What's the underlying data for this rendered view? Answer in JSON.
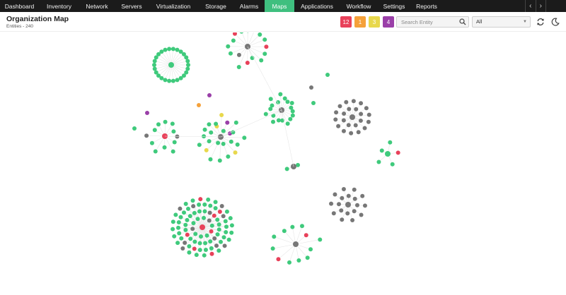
{
  "nav": {
    "items": [
      {
        "label": "Dashboard",
        "w": 55
      },
      {
        "label": "Inventory",
        "w": 57
      },
      {
        "label": "Network",
        "w": 50
      },
      {
        "label": "Servers",
        "w": 48
      },
      {
        "label": "Virtualization",
        "w": 70
      },
      {
        "label": "Storage",
        "w": 50
      },
      {
        "label": "Alarms",
        "w": 44
      },
      {
        "label": "Maps",
        "w": 42
      },
      {
        "label": "Applications",
        "w": 64
      },
      {
        "label": "Workflow",
        "w": 54
      },
      {
        "label": "Settings",
        "w": 46
      },
      {
        "label": "Reports",
        "w": 46
      }
    ],
    "active": "Maps"
  },
  "header": {
    "title": "Organization Map",
    "entities": "Entities - 240"
  },
  "badges": [
    {
      "value": "12",
      "color": "#e8415a"
    },
    {
      "value": "1",
      "color": "#f5a13a"
    },
    {
      "value": "3",
      "color": "#e8d84c"
    },
    {
      "value": "4",
      "color": "#9a3fa8"
    }
  ],
  "search": {
    "placeholder": "Search Entity",
    "value": ""
  },
  "filter": {
    "selected": "All"
  },
  "icons": {
    "search": "search-icon",
    "refresh": "refresh-icon",
    "theme": "dark-mode-icon",
    "prev": "chevron-left-icon",
    "next": "chevron-right-icon"
  },
  "colors": {
    "up": "#3fca7c",
    "down": "#e8415a",
    "trouble": "#f5a13a",
    "attention": "#e8d84c",
    "critical": "#9a3fa8",
    "unmanaged": "#777777",
    "accent": "#3fbf7f"
  },
  "map": {
    "clusters": [
      {
        "center": "up",
        "ring": [
          "up"
        ],
        "count": 26
      },
      {
        "center": "unmanaged",
        "ring": [
          "up",
          "down",
          "unmanaged"
        ],
        "count": 16
      },
      {
        "center": "unmanaged",
        "ring": [
          "up"
        ],
        "count": 18
      },
      {
        "center": "unmanaged",
        "ring": [
          "unmanaged"
        ],
        "count": 22
      },
      {
        "center": "down",
        "ring": [
          "up",
          "unmanaged"
        ],
        "count": 12
      },
      {
        "center": "unmanaged",
        "ring": [
          "up",
          "attention",
          "critical"
        ],
        "count": 24
      },
      {
        "center": "up",
        "ring": [
          "up",
          "down"
        ],
        "count": 5
      },
      {
        "center": "unmanaged",
        "ring": [
          "up"
        ],
        "count": 2
      },
      {
        "center": "unmanaged",
        "ring": [
          "unmanaged"
        ],
        "count": 18
      },
      {
        "center": "down",
        "ring": [
          "up",
          "unmanaged",
          "down"
        ],
        "count": 80
      },
      {
        "center": "unmanaged",
        "ring": [
          "up",
          "down"
        ],
        "count": 12
      }
    ]
  }
}
